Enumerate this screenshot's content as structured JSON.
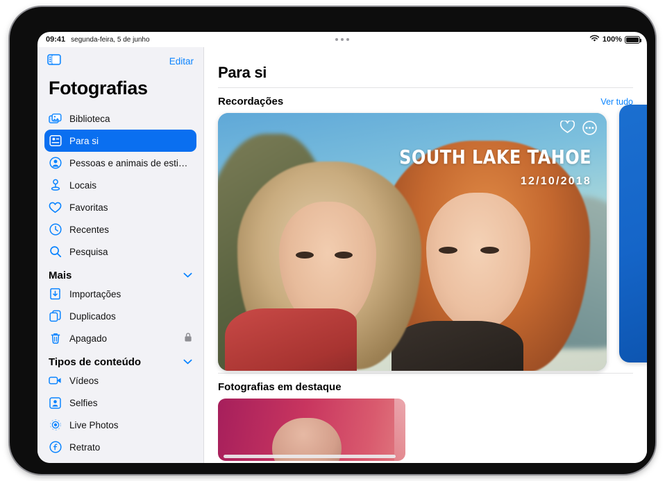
{
  "status_bar": {
    "time": "09:41",
    "date": "segunda-feira, 5 de junho",
    "battery_percent": "100%",
    "wifi_icon": "wifi-icon",
    "battery_icon": "battery-full-icon",
    "multitask_handle": "multitasking-handle"
  },
  "sidebar": {
    "toggle_icon": "sidebar-toggle-icon",
    "edit_label": "Editar",
    "title": "Fotografias",
    "items": [
      {
        "label": "Biblioteca",
        "icon": "photo-stack-icon",
        "selected": false
      },
      {
        "label": "Para si",
        "icon": "for-you-icon",
        "selected": true
      },
      {
        "label": "Pessoas e animais de estim…",
        "icon": "person-circle-icon",
        "selected": false
      },
      {
        "label": "Locais",
        "icon": "map-pin-icon",
        "selected": false
      },
      {
        "label": "Favoritas",
        "icon": "heart-icon",
        "selected": false
      },
      {
        "label": "Recentes",
        "icon": "clock-icon",
        "selected": false
      },
      {
        "label": "Pesquisa",
        "icon": "search-icon",
        "selected": false
      }
    ],
    "groups": [
      {
        "label": "Mais",
        "chevron": "chevron-down-icon",
        "items": [
          {
            "label": "Importações",
            "icon": "import-icon",
            "trailing": ""
          },
          {
            "label": "Duplicados",
            "icon": "duplicate-icon",
            "trailing": ""
          },
          {
            "label": "Apagado",
            "icon": "trash-icon",
            "trailing": "lock-icon"
          }
        ]
      },
      {
        "label": "Tipos de conteúdo",
        "chevron": "chevron-down-icon",
        "items": [
          {
            "label": "Vídeos",
            "icon": "video-icon",
            "trailing": ""
          },
          {
            "label": "Selfies",
            "icon": "selfie-icon",
            "trailing": ""
          },
          {
            "label": "Live Photos",
            "icon": "live-photo-icon",
            "trailing": ""
          },
          {
            "label": "Retrato",
            "icon": "portrait-icon",
            "trailing": ""
          }
        ]
      }
    ]
  },
  "main": {
    "title": "Para si",
    "memories": {
      "section_title": "Recordações",
      "see_all_label": "Ver tudo",
      "card": {
        "title": "SOUTH LAKE TAHOE",
        "date": "12/10/2018",
        "favorite_icon": "heart-icon",
        "more_icon": "ellipsis-circle-icon"
      },
      "peek_card": "memory-card-next"
    },
    "featured": {
      "section_title": "Fotografias em destaque"
    }
  },
  "colors": {
    "accent_blue": "#0a84ff",
    "selected_blue": "#0a6ff0",
    "sidebar_bg": "#f2f2f6",
    "divider": "#e2e2e4"
  }
}
